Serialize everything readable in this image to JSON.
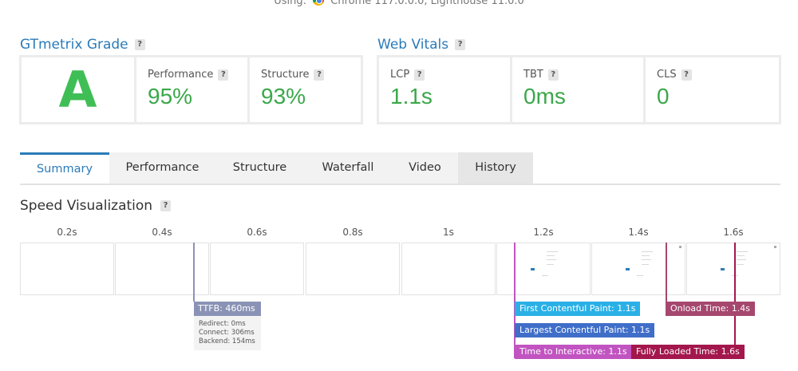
{
  "using_text": "Using:",
  "using_browser": "Chrome 117.0.0.0, Lighthouse 11.0.0",
  "grade": {
    "title": "GTmetrix Grade",
    "letter": "A",
    "metrics": [
      {
        "label": "Performance",
        "value": "95%"
      },
      {
        "label": "Structure",
        "value": "93%"
      }
    ]
  },
  "vitals": {
    "title": "Web Vitals",
    "metrics": [
      {
        "label": "LCP",
        "value": "1.1s"
      },
      {
        "label": "TBT",
        "value": "0ms"
      },
      {
        "label": "CLS",
        "value": "0"
      }
    ]
  },
  "help_glyph": "?",
  "tabs": [
    "Summary",
    "Performance",
    "Structure",
    "Waterfall",
    "Video",
    "History"
  ],
  "active_tab": "Summary",
  "speed": {
    "title": "Speed Visualization",
    "ticks": [
      "0.2s",
      "0.4s",
      "0.6s",
      "0.8s",
      "1s",
      "1.2s",
      "1.4s",
      "1.6s"
    ],
    "ttfb": {
      "label": "TTFB: 460ms",
      "details": [
        "Redirect: 0ms",
        "Connect: 306ms",
        "Backend: 154ms"
      ]
    },
    "markers": {
      "fcp": "First Contentful Paint: 1.1s",
      "lcp": "Largest Contentful Paint: 1.1s",
      "tti": "Time to Interactive: 1.1s",
      "onload": "Onload Time: 1.4s",
      "fully": "Fully Loaded Time: 1.6s"
    }
  },
  "colors": {
    "accent": "#2b7bb9",
    "grade_green": "#3fbe56",
    "value_green": "#3aa84a",
    "ttfb": "#8a93b5",
    "fcp": "#2ab0e6",
    "lcp": "#3f6ec9",
    "tti": "#c154c1",
    "onload": "#a5476e",
    "fully": "#a3174c"
  },
  "icons": {
    "browser": "chrome-icon",
    "help": "help-icon"
  }
}
